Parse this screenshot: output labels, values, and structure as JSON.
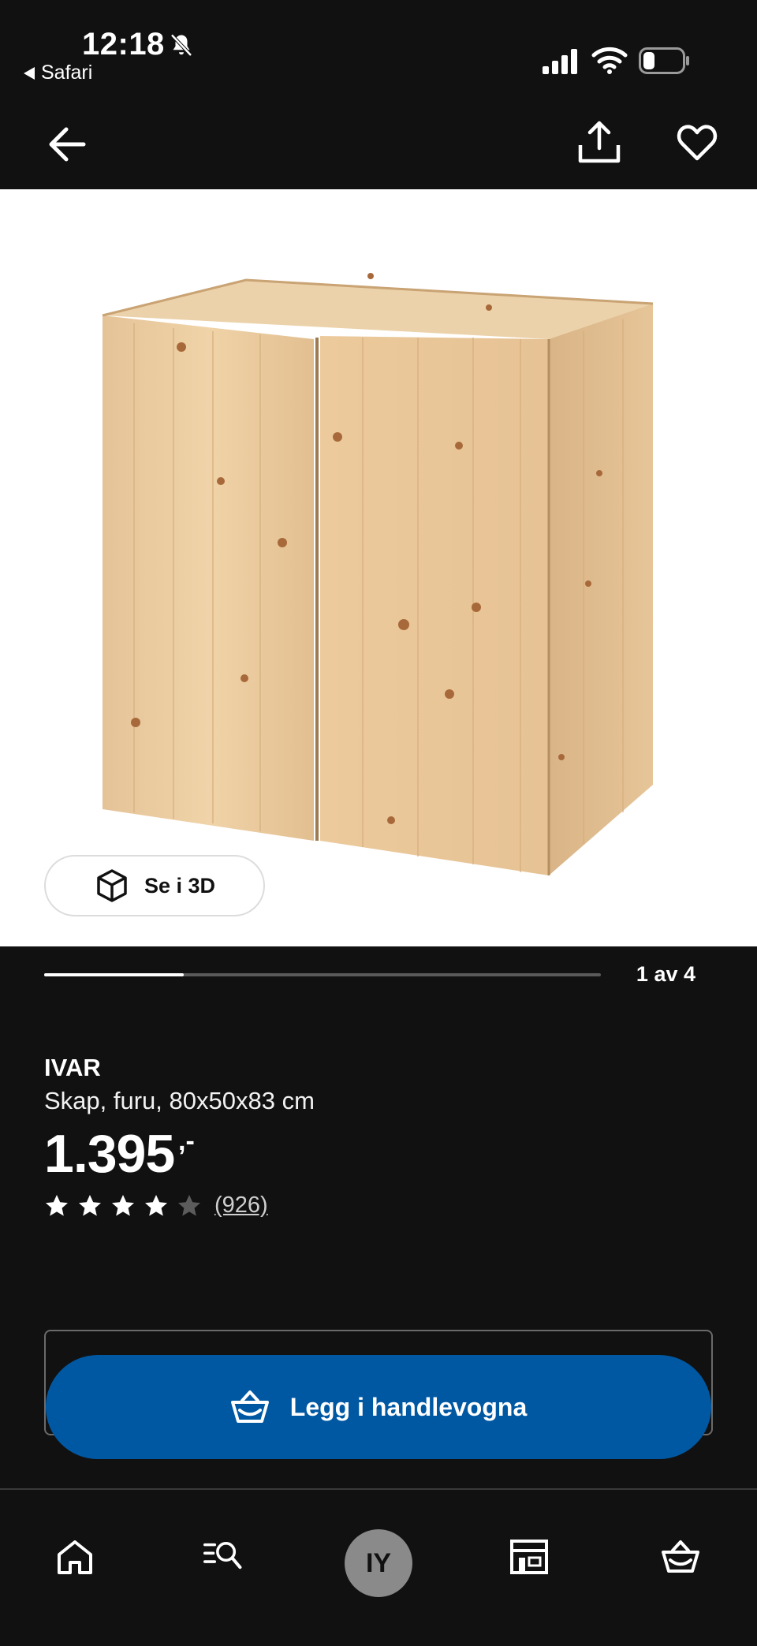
{
  "status_bar": {
    "time": "12:18",
    "back_app_label": "Safari",
    "icons": [
      "bell-slash-icon",
      "cellular-signal-icon",
      "wifi-icon",
      "battery-icon"
    ]
  },
  "nav_header": {
    "icons": [
      "arrow-left-icon",
      "share-icon",
      "heart-icon"
    ]
  },
  "gallery": {
    "view_3d_label": "Se i 3D",
    "pager_text": "1 av 4",
    "progress": 0.25
  },
  "product": {
    "name": "IVAR",
    "description": "Skap, furu, 80x50x83 cm",
    "price": "1.395",
    "price_suffix": ",-",
    "rating_value": 4,
    "rating_max": 5,
    "review_count": "(926)"
  },
  "cta": {
    "label": "Legg i handlevogna",
    "color": "#0058a3"
  },
  "bottom_nav": {
    "avatar_initials": "IY",
    "items": [
      "home-icon",
      "search-icon",
      "profile-avatar",
      "store-icon",
      "basket-icon"
    ]
  }
}
